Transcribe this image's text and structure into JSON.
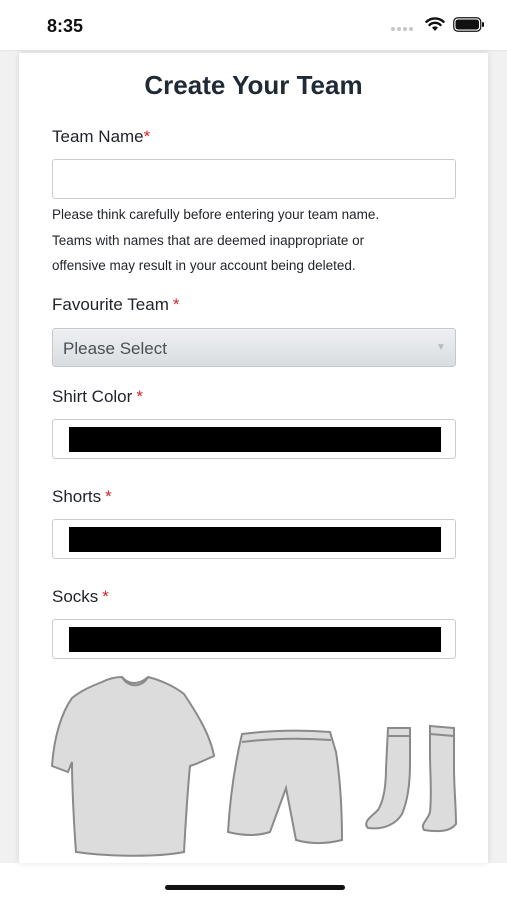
{
  "status_bar": {
    "time": "8:35"
  },
  "page": {
    "title": "Create Your Team"
  },
  "form": {
    "team_name": {
      "label": "Team Name",
      "required_mark": "*",
      "value": "",
      "help_lines": [
        "Please think carefully before entering your team name.",
        "Teams with names that are deemed inappropriate or",
        "offensive may result in your account being deleted."
      ]
    },
    "favourite_team": {
      "label": "Favourite Team",
      "required_mark": "*",
      "selected": "Please Select"
    },
    "shirt_color": {
      "label": "Shirt Color",
      "required_mark": "*",
      "value_color": "#000000"
    },
    "shorts": {
      "label": "Shorts",
      "required_mark": "*",
      "value_color": "#000000"
    },
    "socks": {
      "label": "Socks",
      "required_mark": "*",
      "value_color": "#000000"
    }
  },
  "kit_preview": {
    "fill_color": "#dcdcdc",
    "outline_color": "#8a8a8a",
    "items": [
      "shirt-icon",
      "shorts-icon",
      "socks-icon"
    ]
  },
  "theme": {
    "required_color": "#d0262d",
    "title_color": "#1f2a36"
  }
}
